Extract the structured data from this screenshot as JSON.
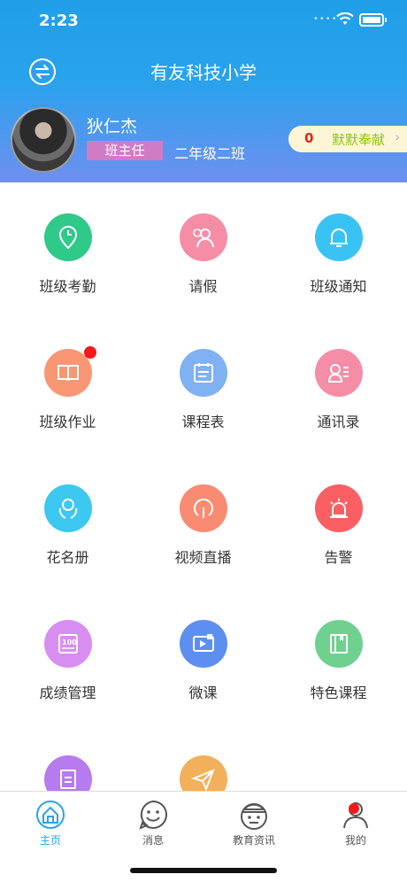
{
  "status_bar": {
    "time": "2:23"
  },
  "header": {
    "title": "有友科技小学",
    "user_name": "狄仁杰",
    "role": "班主任",
    "class_name": "二年级二班",
    "contribution_count": "0",
    "contribution_label": "默默奉献"
  },
  "grid": {
    "items": [
      {
        "label": "班级考勤",
        "icon": "clock-pin-icon",
        "color": "#2fc98a"
      },
      {
        "label": "请假",
        "icon": "person-clock-icon",
        "color": "#f58da7"
      },
      {
        "label": "班级通知",
        "icon": "bell-icon",
        "color": "#39c3f5"
      },
      {
        "label": "班级作业",
        "icon": "book-icon",
        "color": "#f99674",
        "badge": true
      },
      {
        "label": "课程表",
        "icon": "calendar-icon",
        "color": "#7fb1f3"
      },
      {
        "label": "通讯录",
        "icon": "contacts-icon",
        "color": "#f58da7"
      },
      {
        "label": "花名册",
        "icon": "roster-icon",
        "color": "#3cc8f0"
      },
      {
        "label": "视频直播",
        "icon": "live-icon",
        "color": "#f98b72"
      },
      {
        "label": "告警",
        "icon": "alarm-icon",
        "color": "#f95f63"
      },
      {
        "label": "成绩管理",
        "icon": "score-icon",
        "color": "#d78ef0"
      },
      {
        "label": "微课",
        "icon": "video-course-icon",
        "color": "#5d8ff0"
      },
      {
        "label": "特色课程",
        "icon": "feature-book-icon",
        "color": "#6fd08f"
      },
      {
        "label": "",
        "icon": "document-icon",
        "color": "#b77bf0"
      },
      {
        "label": "",
        "icon": "paper-plane-icon",
        "color": "#f2b05a"
      }
    ]
  },
  "tabs": [
    {
      "label": "主页",
      "icon": "home-icon",
      "active": true
    },
    {
      "label": "消息",
      "icon": "smile-message-icon",
      "active": false
    },
    {
      "label": "教育资讯",
      "icon": "news-icon",
      "active": false
    },
    {
      "label": "我的",
      "icon": "profile-icon",
      "active": false,
      "badge": true
    }
  ],
  "colors": {
    "header_top": "#1f9fe8",
    "header_bottom": "#6f8ff0",
    "tab_active": "#2aa2ec",
    "badge_red": "#f41a1a"
  }
}
